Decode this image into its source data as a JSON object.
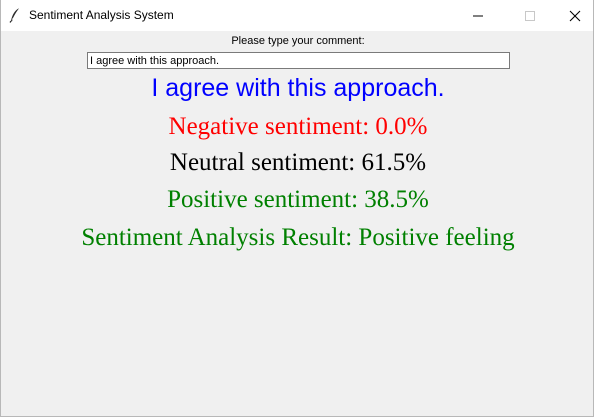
{
  "window": {
    "title": "Sentiment Analysis System",
    "app_icon": "feather-icon",
    "controls": {
      "minimize_icon": "minimize-icon",
      "maximize_icon": "maximize-icon",
      "close_icon": "close-icon"
    }
  },
  "form": {
    "prompt_label": "Please type your comment:",
    "comment_value": "I agree with this approach."
  },
  "output": {
    "echo_text": "I agree with this approach.",
    "negative_text": "Negative sentiment: 0.0%",
    "neutral_text": "Neutral sentiment: 61.5%",
    "positive_text": "Positive sentiment: 38.5%",
    "result_text": "Sentiment Analysis Result: Positive feeling"
  },
  "colors": {
    "echo": "#0000ff",
    "negative": "#ff0000",
    "neutral": "#000000",
    "positive": "#008000",
    "result": "#008000"
  }
}
